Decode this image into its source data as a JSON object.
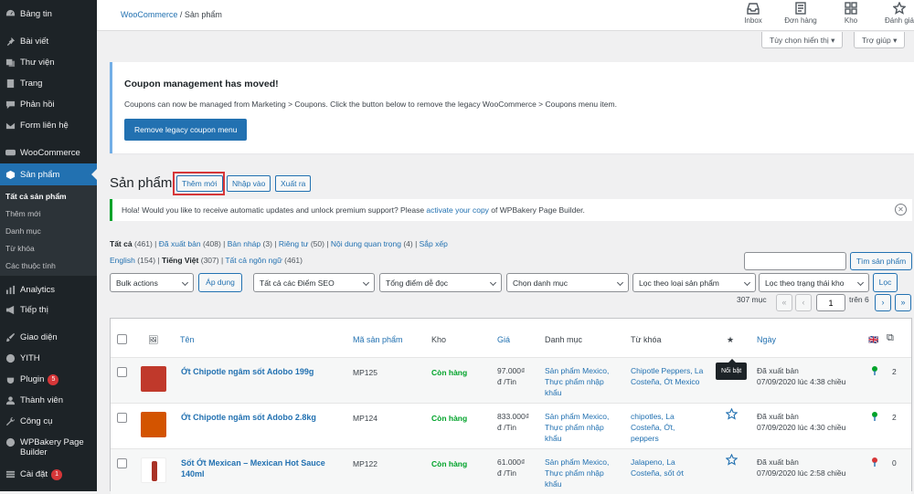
{
  "sidebar": {
    "items": [
      {
        "label": "Bảng tin",
        "icon": "dashboard-icon"
      },
      {
        "label": "Bài viết",
        "icon": "pin-icon"
      },
      {
        "label": "Thư viện",
        "icon": "media-icon"
      },
      {
        "label": "Trang",
        "icon": "page-icon"
      },
      {
        "label": "Phản hồi",
        "icon": "comment-icon"
      },
      {
        "label": "Form liên hệ",
        "icon": "mail-icon"
      },
      {
        "label": "WooCommerce",
        "icon": "woo-icon"
      },
      {
        "label": "Sản phẩm",
        "icon": "product-icon"
      },
      {
        "label": "Analytics",
        "icon": "chart-icon"
      },
      {
        "label": "Tiếp thị",
        "icon": "megaphone-icon"
      },
      {
        "label": "Giao diện",
        "icon": "brush-icon"
      },
      {
        "label": "YITH",
        "icon": "yith-icon"
      },
      {
        "label": "Plugin",
        "icon": "plugin-icon",
        "badge": "5"
      },
      {
        "label": "Thành viên",
        "icon": "users-icon"
      },
      {
        "label": "Công cụ",
        "icon": "wrench-icon"
      },
      {
        "label": "WPBakery Page Builder",
        "icon": "wpbakery-icon"
      },
      {
        "label": "Cài đặt",
        "icon": "settings-icon",
        "badge": "1"
      }
    ],
    "submenu": [
      "Tất cả sản phẩm",
      "Thêm mới",
      "Danh mục",
      "Từ khóa",
      "Các thuộc tính"
    ]
  },
  "topbar": {
    "breadcrumb_link": "WooCommerce",
    "breadcrumb_sep": "/",
    "breadcrumb_current": "Sản phẩm",
    "icons": [
      {
        "label": "Inbox",
        "icon": "inbox-icon"
      },
      {
        "label": "Đơn hàng",
        "icon": "orders-icon"
      },
      {
        "label": "Kho",
        "icon": "stock-icon"
      },
      {
        "label": "Đánh giá",
        "icon": "star-icon"
      }
    ],
    "screen_options": "Tùy chọn hiển thị",
    "help": "Trợ giúp"
  },
  "notice": {
    "title": "Coupon management has moved!",
    "text": "Coupons can now be managed from Marketing > Coupons. Click the button below to remove the legacy WooCommerce > Coupons menu item.",
    "button": "Remove legacy coupon menu"
  },
  "page": {
    "title": "Sản phẩm",
    "add_new": "Thêm mới",
    "import": "Nhập vào",
    "export": "Xuất ra"
  },
  "hola": {
    "before": "Hola! Would you like to receive automatic updates and unlock premium support? Please ",
    "link": "activate your copy",
    "after": " of WPBakery Page Builder."
  },
  "views": {
    "all": "Tất cả",
    "all_count": "(461)",
    "published": "Đã xuất bản",
    "published_count": "(408)",
    "draft": "Bản nháp",
    "draft_count": "(3)",
    "private": "Riêng tư",
    "private_count": "(50)",
    "cornerstone": "Nội dung quan trọng",
    "cornerstone_count": "(4)",
    "sort": "Sắp xếp",
    "english": "English",
    "english_count": "(154)",
    "vietnamese": "Tiếng Việt",
    "vietnamese_count": "(307)",
    "all_langs": "Tất cả ngôn ngữ",
    "all_langs_count": "(461)"
  },
  "search": {
    "button": "Tìm sản phẩm",
    "value": ""
  },
  "filters": {
    "bulk": "Bulk actions",
    "apply": "Áp dụng",
    "seo": "Tất cả các Điểm SEO",
    "readability": "Tổng điểm dễ đọc",
    "category": "Chọn danh mục",
    "type": "Lọc theo loại sản phẩm",
    "stock": "Lọc theo trạng thái kho",
    "filter_btn": "Lọc"
  },
  "pagination": {
    "items": "307 mục",
    "first": "«",
    "prev": "‹",
    "current": "1",
    "of": "trên 6",
    "next": "›",
    "last": "»"
  },
  "table": {
    "headers": {
      "name": "Tên",
      "sku": "Mã sản phẩm",
      "stock": "Kho",
      "price": "Giá",
      "categories": "Danh mục",
      "tags": "Từ khóa",
      "date": "Ngày"
    },
    "tooltip": "Nổi bật",
    "rows": [
      {
        "name": "Ớt Chipotle ngâm sốt Adobo 199g",
        "sku": "MP125",
        "stock": "Còn hàng",
        "price1": "97.000₫",
        "price2": "đ /Tin",
        "cat1": "Sản phẩm Mexico,",
        "cat2": "Thực phẩm nhập",
        "cat3": "khẩu",
        "tag1": "Chipotle Peppers, La",
        "tag2": "Costeña, Ớt Mexico",
        "tag3": "",
        "status": "Đã xuất bản",
        "date": "07/09/2020 lúc 4:38 chiều",
        "count": "2",
        "featured": true,
        "thumb_color": "#c0392b"
      },
      {
        "name": "Ớt Chipotle ngâm sốt Adobo 2.8kg",
        "sku": "MP124",
        "stock": "Còn hàng",
        "price1": "833.000₫",
        "price2": "đ /Tin",
        "cat1": "Sản phẩm Mexico,",
        "cat2": "Thực phẩm nhập",
        "cat3": "khẩu",
        "tag1": "chipotles, La",
        "tag2": "Costeña, Ớt,",
        "tag3": "peppers",
        "status": "Đã xuất bản",
        "date": "07/09/2020 lúc 4:30 chiều",
        "count": "2",
        "featured": false,
        "thumb_color": "#d35400"
      },
      {
        "name": "Sốt Ớt Mexican – Mexican Hot Sauce",
        "name2": "140ml",
        "sku": "MP122",
        "stock": "Còn hàng",
        "price1": "61.000₫",
        "price2": "đ /Tin",
        "cat1": "Sản phẩm Mexico,",
        "cat2": "Thực phẩm nhập",
        "cat3": "khẩu",
        "tag1": "Jalapeno, La",
        "tag2": "Costeña, sốt ớt",
        "tag3": "",
        "status": "Đã xuất bản",
        "date": "07/09/2020 lúc 2:58 chiều",
        "count": "0",
        "featured": false,
        "thumb_color": "#a93226"
      }
    ]
  }
}
